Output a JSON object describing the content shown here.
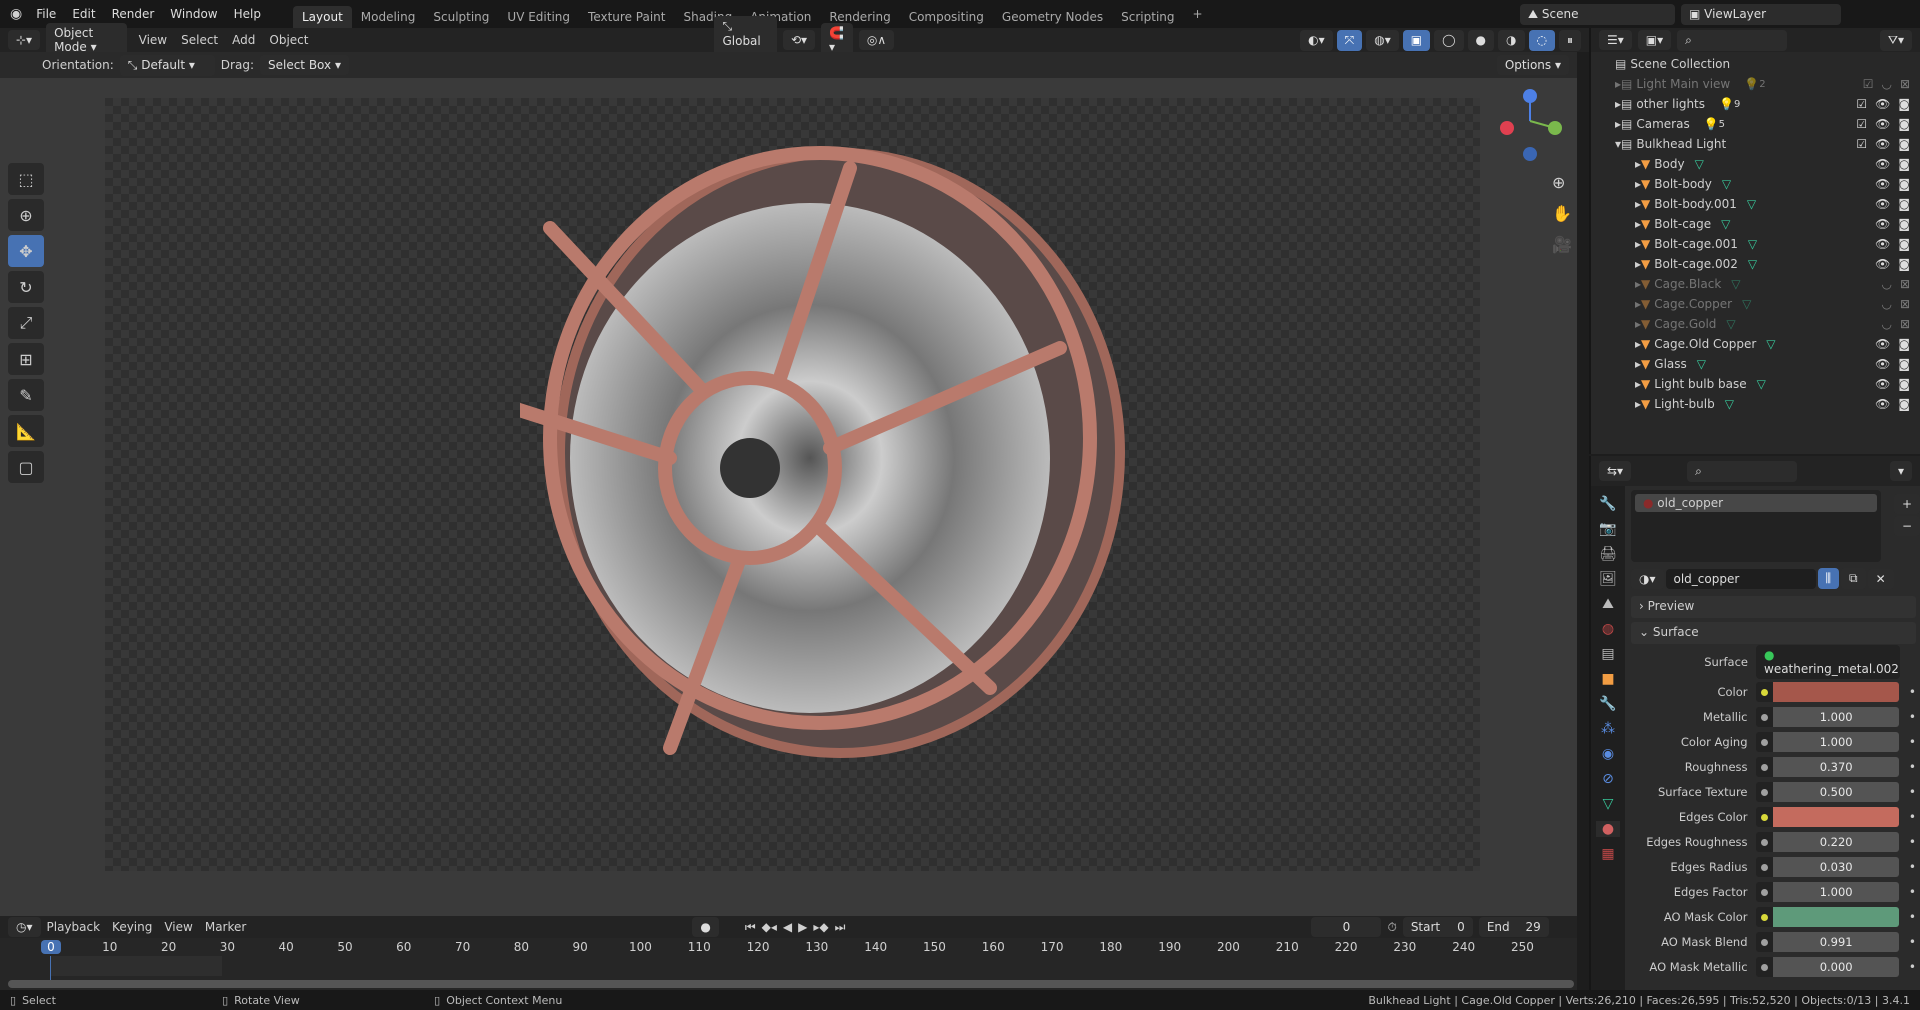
{
  "menu": [
    "File",
    "Edit",
    "Render",
    "Window",
    "Help"
  ],
  "workspaces": [
    "Layout",
    "Modeling",
    "Sculpting",
    "UV Editing",
    "Texture Paint",
    "Shading",
    "Animation",
    "Rendering",
    "Compositing",
    "Geometry Nodes",
    "Scripting"
  ],
  "scene": "Scene",
  "view_layer": "ViewLayer",
  "header": {
    "mode": "Object Mode",
    "menus": [
      "View",
      "Select",
      "Add",
      "Object"
    ],
    "transform": "Global",
    "options": "Options"
  },
  "tool_settings": {
    "orientation_label": "Orientation:",
    "orientation": "Default",
    "drag_label": "Drag:",
    "drag": "Select Box"
  },
  "outliner": {
    "root": "Scene Collection",
    "collections": [
      {
        "name": "Light Main view",
        "count": "2",
        "dim": true
      },
      {
        "name": "other lights",
        "count": "9"
      },
      {
        "name": "Cameras",
        "count": "5"
      },
      {
        "name": "Bulkhead Light"
      }
    ],
    "objects": [
      {
        "name": "Body"
      },
      {
        "name": "Bolt-body"
      },
      {
        "name": "Bolt-body.001"
      },
      {
        "name": "Bolt-cage"
      },
      {
        "name": "Bolt-cage.001"
      },
      {
        "name": "Bolt-cage.002"
      },
      {
        "name": "Cage.Black",
        "dim": true
      },
      {
        "name": "Cage.Copper",
        "dim": true
      },
      {
        "name": "Cage.Gold",
        "dim": true
      },
      {
        "name": "Cage.Old Copper"
      },
      {
        "name": "Glass"
      },
      {
        "name": "Light bulb base"
      },
      {
        "name": "Light-bulb"
      }
    ]
  },
  "properties": {
    "slot": "old_copper",
    "material": "old_copper",
    "preview": "Preview",
    "surface_panel": "Surface",
    "surface_label": "Surface",
    "surface_shader": "weathering_metal.002",
    "inputs": [
      {
        "label": "Color",
        "type": "color",
        "color": "#a5574b"
      },
      {
        "label": "Metallic",
        "value": "1.000",
        "fraction": 1
      },
      {
        "label": "Color Aging",
        "value": "1.000",
        "fraction": 1
      },
      {
        "label": "Roughness",
        "value": "0.370",
        "fraction": 0.37
      },
      {
        "label": "Surface Texture",
        "value": "0.500",
        "fraction": 0
      },
      {
        "label": "Edges Color",
        "type": "color",
        "color": "#c46b5e"
      },
      {
        "label": "Edges Roughness",
        "value": "0.220",
        "fraction": 0
      },
      {
        "label": "Edges Radius",
        "value": "0.030",
        "fraction": 0
      },
      {
        "label": "Edges Factor",
        "value": "1.000",
        "fraction": 0
      },
      {
        "label": "AO Mask Color",
        "type": "color",
        "color": "#5e9a7a"
      },
      {
        "label": "AO Mask Blend",
        "value": "0.991",
        "fraction": 1
      },
      {
        "label": "AO Mask Metallic",
        "value": "0.000",
        "fraction": 0
      }
    ]
  },
  "timeline": {
    "menus": [
      "Playback",
      "Keying",
      "View",
      "Marker"
    ],
    "current_frame": "0",
    "start_label": "Start",
    "start": "0",
    "end_label": "End",
    "end": "29",
    "ticks": [
      "0",
      "10",
      "20",
      "30",
      "40",
      "50",
      "60",
      "70",
      "80",
      "90",
      "100",
      "110",
      "120",
      "130",
      "140",
      "150",
      "160",
      "170",
      "180",
      "190",
      "200",
      "210",
      "220",
      "230",
      "240",
      "250"
    ]
  },
  "status": {
    "select": "Select",
    "rotate": "Rotate View",
    "context": "Object Context Menu",
    "stats": "Bulkhead Light | Cage.Old Copper | Verts:26,210 | Faces:26,595 | Tris:52,520 | Objects:0/13 | 3.4.1"
  }
}
